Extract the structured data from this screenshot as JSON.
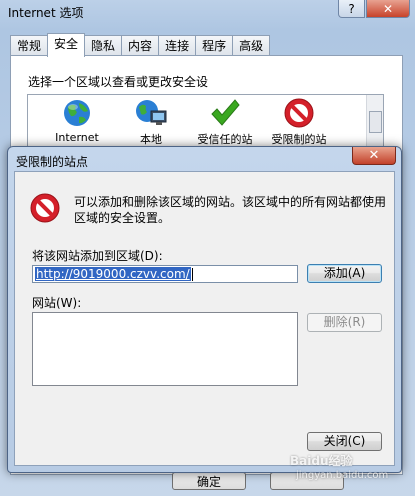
{
  "outer_window": {
    "title": "Internet 选项",
    "help_glyph": "?",
    "close_glyph": "✕",
    "tabs": [
      {
        "label": "常规",
        "active": false
      },
      {
        "label": "安全",
        "active": true
      },
      {
        "label": "隐私",
        "active": false
      },
      {
        "label": "内容",
        "active": false
      },
      {
        "label": "连接",
        "active": false
      },
      {
        "label": "程序",
        "active": false
      },
      {
        "label": "高级",
        "active": false
      }
    ],
    "zone_prompt": "选择一个区域以查看或更改安全设",
    "zones": [
      {
        "label": "Internet",
        "icon": "globe-icon"
      },
      {
        "label": "本地",
        "icon": "local-intranet-icon"
      },
      {
        "label": "受信任的站",
        "icon": "trusted-checkmark-icon"
      },
      {
        "label": "受限制的站",
        "icon": "restricted-stop-icon"
      }
    ],
    "ok_label": "确定"
  },
  "dialog": {
    "title": "受限制的站点",
    "close_glyph": "✕",
    "description": "可以添加和删除该区域的网站。该区域中的所有网站都使用区域的安全设置。",
    "add_label": "将该网站添加到区域(D):",
    "add_value": "http://9019000.czvv.com/",
    "add_button": "添加(A)",
    "sites_label": "网站(W):",
    "remove_button": "删除(R)",
    "close_button": "关闭(C)"
  },
  "watermark": {
    "text": "Baidu经验",
    "sub": "jingyan.baidu.com"
  },
  "colors": {
    "stop_red": "#d4202a",
    "check_green": "#3aa820",
    "selection_blue": "#3166c3"
  }
}
